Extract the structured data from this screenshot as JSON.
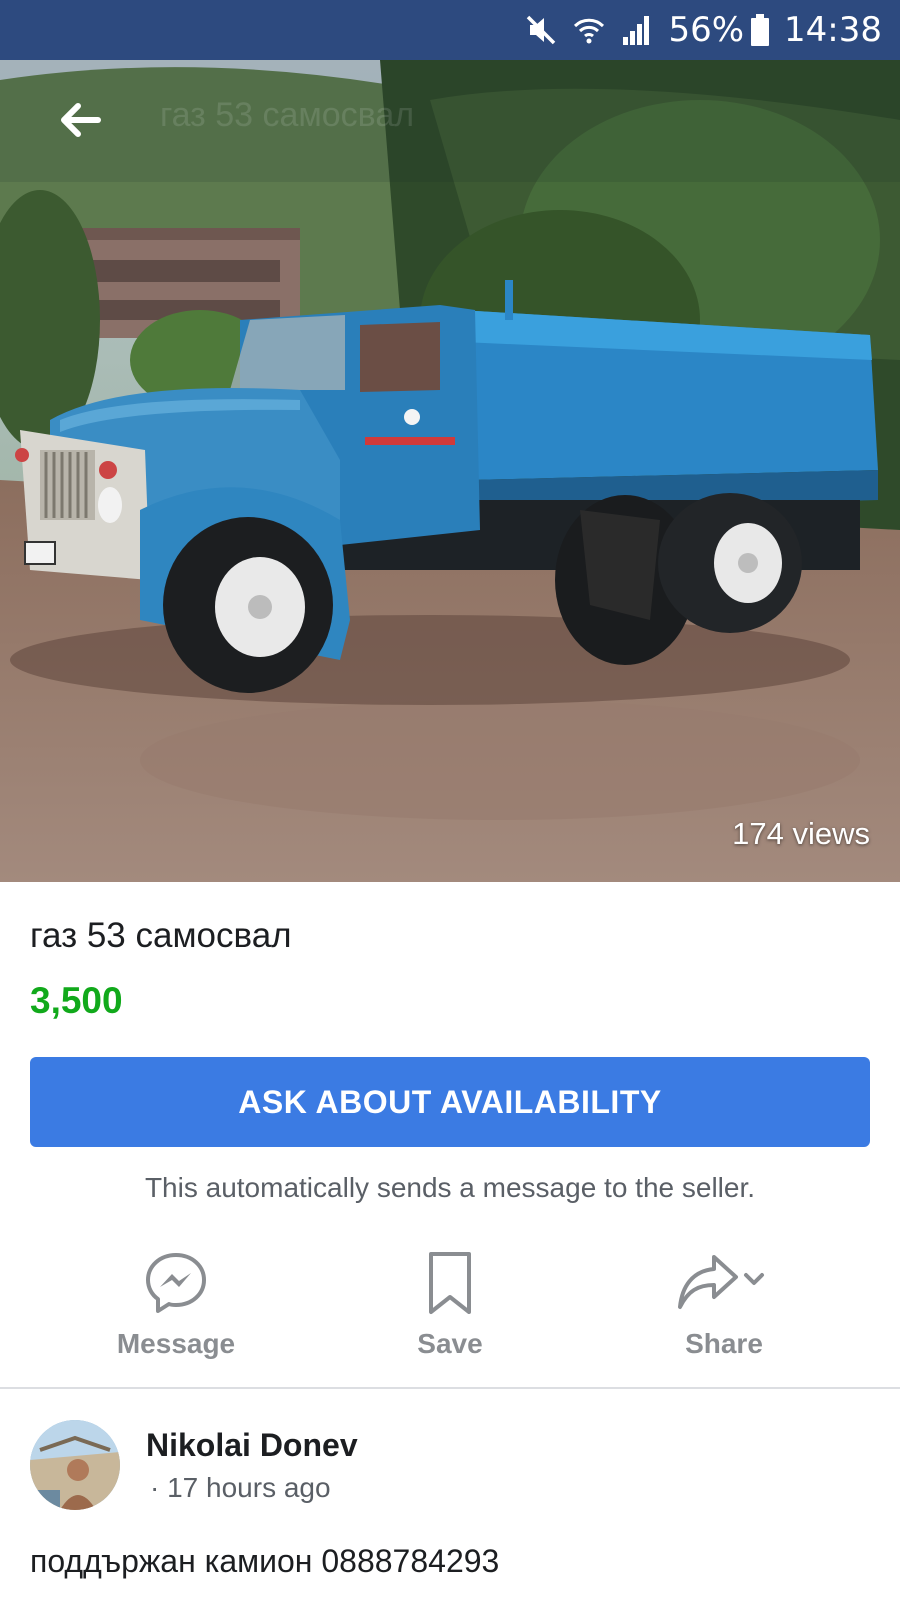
{
  "status_bar": {
    "battery": "56%",
    "time": "14:38",
    "icons": [
      "mute-icon",
      "wifi-icon",
      "signal-icon",
      "battery-icon"
    ]
  },
  "header": {
    "back_icon": "arrow-left-icon",
    "title": "газ 53 самосвал"
  },
  "photo": {
    "views": "174 views"
  },
  "listing": {
    "title": "газ 53 самосвал",
    "price": "3,500",
    "price_color": "#11a91b"
  },
  "cta": {
    "label": "ASK ABOUT AVAILABILITY",
    "note": "This automatically sends a message to the seller.",
    "color": "#3b7be3"
  },
  "actions": [
    {
      "label": "Message",
      "icon": "messenger-icon"
    },
    {
      "label": "Save",
      "icon": "bookmark-icon"
    },
    {
      "label": "Share",
      "icon": "share-icon"
    }
  ],
  "seller": {
    "name": "Nikolai Donev",
    "time": "· 17 hours ago"
  },
  "description": "поддържан камион 0888784293",
  "colors": {
    "status_bar": "#2d4a7f",
    "muted_text": "#8a8d91"
  }
}
